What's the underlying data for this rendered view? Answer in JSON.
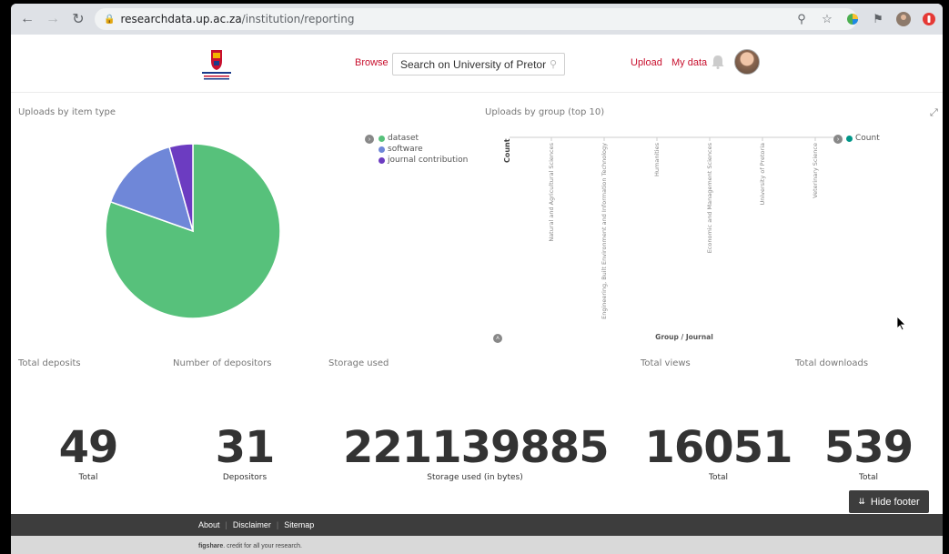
{
  "browser": {
    "url_host": "researchdata.up.ac.za",
    "url_path": "/institution/reporting"
  },
  "header": {
    "browse_label": "Browse",
    "search_placeholder": "Search on University of Pretoria...",
    "upload_label": "Upload",
    "mydata_label": "My data"
  },
  "pie_panel": {
    "title": "Uploads by item type",
    "legend": [
      {
        "label": "dataset",
        "color": "#57c17b"
      },
      {
        "label": "software",
        "color": "#6f87d8"
      },
      {
        "label": "journal contribution",
        "color": "#6c3cc1"
      }
    ]
  },
  "bar_panel": {
    "title": "Uploads by group (top 10)",
    "y_label": "Count",
    "x_label": "Group / Journal",
    "legend_label": "Count",
    "legend_color": "#009688"
  },
  "chart_data": [
    {
      "type": "pie",
      "title": "Uploads by item type",
      "categories": [
        "dataset",
        "software",
        "journal contribution"
      ],
      "values": [
        37,
        7,
        2
      ],
      "colors": [
        "#57c17b",
        "#6f87d8",
        "#6c3cc1"
      ],
      "legend": "top-right"
    },
    {
      "type": "bar",
      "title": "Uploads by group (top 10)",
      "xlabel": "Group / Journal",
      "ylabel": "Count",
      "categories": [
        "Natural and Agricultural Sciences",
        "Engineering, Built Environment and Information Technology",
        "Humanities",
        "Economic and Management Sciences",
        "University of Pretoria",
        "Veterinary Science"
      ],
      "legend": "top-right"
    }
  ],
  "stats": [
    {
      "label": "Total deposits",
      "value": "49",
      "sub": "Total"
    },
    {
      "label": "Number of depositors",
      "value": "31",
      "sub": "Depositors"
    },
    {
      "label": "Storage used",
      "value": "221139885",
      "sub": "Storage used (in bytes)"
    },
    {
      "label": "Total views",
      "value": "16051",
      "sub": "Total"
    },
    {
      "label": "Total downloads",
      "value": "539",
      "sub": "Total"
    }
  ],
  "hide_footer_label": "Hide footer",
  "footer": {
    "links": [
      "About",
      "Disclaimer",
      "Sitemap"
    ],
    "brand": "figshare",
    "tagline": ". credit for all your research."
  }
}
